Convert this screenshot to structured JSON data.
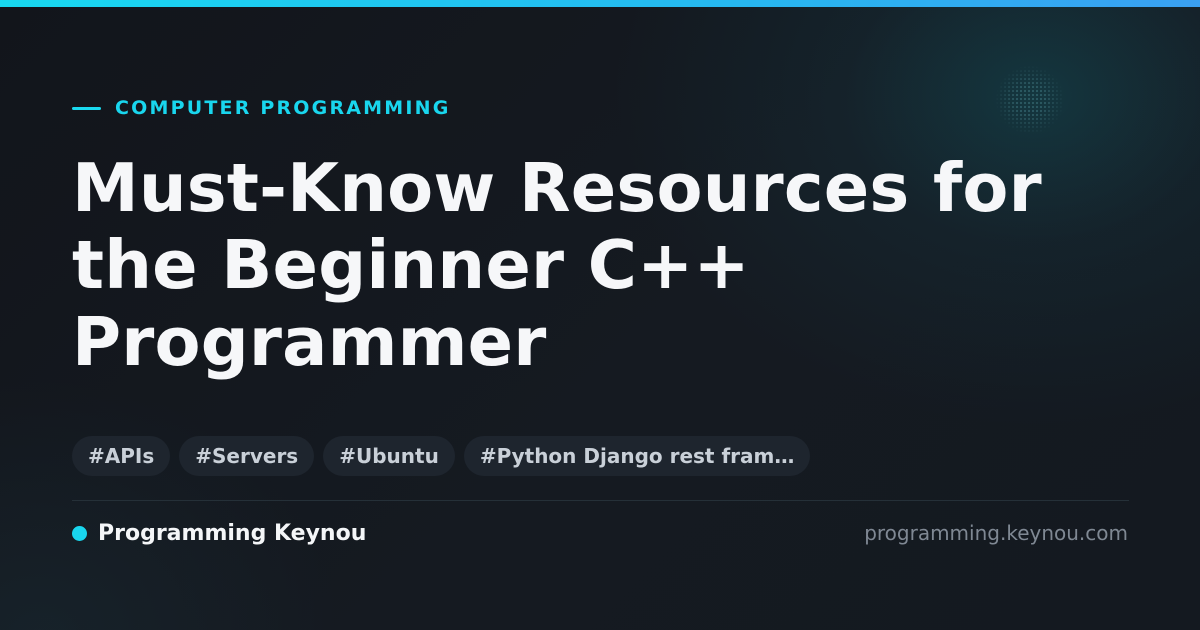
{
  "colors": {
    "accent": "#19d6ee",
    "background": "#13161c",
    "title": "#f6f7f9",
    "tag_background": "#1e252e",
    "tag_text": "#c9d0d8",
    "muted_text": "#7f8893"
  },
  "header": {
    "category": "COMPUTER PROGRAMMING"
  },
  "article": {
    "title_lines": [
      "Must-Know Resources for",
      "the Beginner C++",
      "Programmer"
    ]
  },
  "tags": [
    "#APIs",
    "#Servers",
    "#Ubuntu",
    "#Python Django rest fram…"
  ],
  "footer": {
    "brand_name": "Programming Keynou",
    "domain": "programming.keynou.com"
  }
}
